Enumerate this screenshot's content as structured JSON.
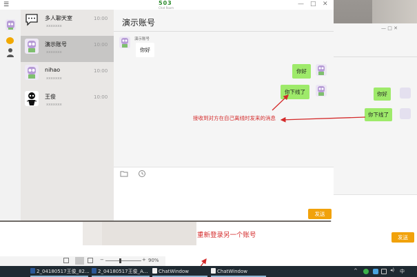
{
  "app": {
    "logo_text": "503",
    "logo_sub": "Chat Room",
    "menu_glyph": "☰",
    "min_glyph": "—",
    "max_glyph": "□",
    "close_glyph": "✕"
  },
  "contacts": [
    {
      "name": "多人聊天室",
      "sub": "xxxxxxx",
      "time": "10:00",
      "icon": "chat-room-icon"
    },
    {
      "name": "演示账号",
      "sub": "xxxxxxx",
      "time": "10:00",
      "icon": "robot-avatar",
      "selected": true
    },
    {
      "name": "nihao",
      "sub": "xxxxxxx",
      "time": "10:00",
      "icon": "robot-avatar"
    },
    {
      "name": "王俊",
      "sub": "xxxxxxx",
      "time": "10:00",
      "icon": "cartoon-avatar"
    }
  ],
  "chat": {
    "title": "演示账号",
    "sender_label": "演示账号",
    "incoming": "你好",
    "outgoing": [
      "你好",
      "你下线了"
    ],
    "send_label": "发送"
  },
  "window2": {
    "controls": "— □ ✕",
    "outgoing": [
      "你好",
      "你下线了"
    ],
    "send_label": "发送"
  },
  "annotations": {
    "offline_msg": "接收到对方在自己离线时发来的消息",
    "relogin": "重新登录另一个账号"
  },
  "word_status": {
    "zoom": "90%",
    "minus": "−",
    "plus": "+"
  },
  "taskbar": {
    "items": [
      {
        "label": "2_04180517王俊_82...",
        "icon": "word-icon"
      },
      {
        "label": "2_04180517王俊_A...",
        "icon": "word-icon"
      },
      {
        "label": "ChatWindow",
        "icon": "app-window-icon"
      },
      {
        "label": "ChatWindow",
        "icon": "app-window-icon"
      }
    ],
    "ime": "中"
  },
  "colors": {
    "send_button": "#f1a20b",
    "bubble_out": "#9eea6a",
    "annotation": "#d42a2a",
    "selected_item": "#c7c6c5"
  }
}
